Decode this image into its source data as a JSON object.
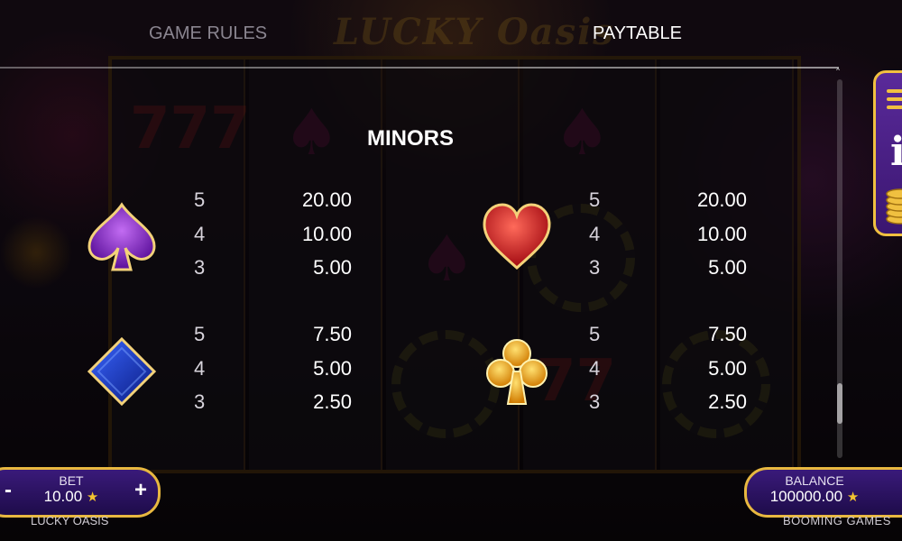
{
  "tabs": {
    "game_rules": "GAME RULES",
    "paytable": "PAYTABLE",
    "active": "PAYTABLE"
  },
  "paytable": {
    "section_title": "MINORS",
    "symbols": [
      {
        "suit": "spade-icon",
        "color": "#8a2cc9",
        "payouts": [
          {
            "count": "5",
            "value": "20.00"
          },
          {
            "count": "4",
            "value": "10.00"
          },
          {
            "count": "3",
            "value": "5.00"
          }
        ]
      },
      {
        "suit": "heart-icon",
        "color": "#d4141c",
        "payouts": [
          {
            "count": "5",
            "value": "20.00"
          },
          {
            "count": "4",
            "value": "10.00"
          },
          {
            "count": "3",
            "value": "5.00"
          }
        ]
      },
      {
        "suit": "diamond-icon",
        "color": "#1533b8",
        "payouts": [
          {
            "count": "5",
            "value": "7.50"
          },
          {
            "count": "4",
            "value": "5.00"
          },
          {
            "count": "3",
            "value": "2.50"
          }
        ]
      },
      {
        "suit": "club-icon",
        "color": "#f2a414",
        "payouts": [
          {
            "count": "5",
            "value": "7.50"
          },
          {
            "count": "4",
            "value": "5.00"
          },
          {
            "count": "3",
            "value": "2.50"
          }
        ]
      }
    ]
  },
  "bet": {
    "label": "BET",
    "value": "10.00",
    "minus": "-",
    "plus": "+"
  },
  "balance": {
    "label": "BALANCE",
    "value": "100000.00"
  },
  "footer": {
    "game_name": "LUCKY OASIS",
    "provider": "BOOMING GAMES"
  },
  "colors": {
    "accent_gold": "#e8b840",
    "panel_purple": "#3a1a7a"
  }
}
